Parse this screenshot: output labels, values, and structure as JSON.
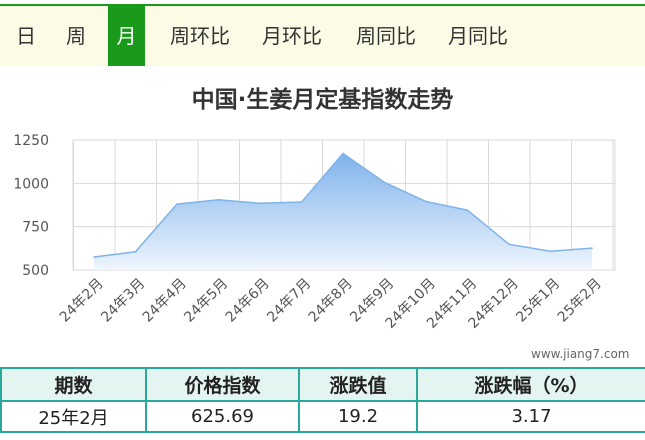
{
  "tabs": [
    {
      "label": "日",
      "active": false
    },
    {
      "label": "周",
      "active": false
    },
    {
      "label": "月",
      "active": true
    },
    {
      "label": "周环比",
      "active": false
    },
    {
      "label": "月环比",
      "active": false
    },
    {
      "label": "周同比",
      "active": false
    },
    {
      "label": "月同比",
      "active": false
    }
  ],
  "watermark": "www.jiang7.com",
  "chart_data": {
    "type": "area",
    "title": "中国·生姜月定基指数走势",
    "categories": [
      "24年2月",
      "24年3月",
      "24年4月",
      "24年5月",
      "24年6月",
      "24年7月",
      "24年8月",
      "24年9月",
      "24年10月",
      "24年11月",
      "24年12月",
      "25年1月",
      "25年2月"
    ],
    "series": [
      {
        "values": [
          575,
          605,
          880,
          905,
          885,
          892,
          1172,
          1005,
          895,
          845,
          648,
          608,
          626
        ]
      }
    ],
    "yticks": [
      500,
      750,
      1000,
      1250
    ],
    "ylim": [
      500,
      1250
    ],
    "grid": true,
    "colors": {
      "line": "#7fb3e8",
      "fill_top": "#7fb3ec",
      "fill_bottom": "#eef5fd",
      "grid": "#d9d9d9"
    }
  },
  "summary_table": {
    "headers": [
      "期数",
      "价格指数",
      "涨跌值",
      "涨跌幅（%）"
    ],
    "row": [
      "25年2月",
      "625.69",
      "19.2",
      "3.17"
    ]
  }
}
